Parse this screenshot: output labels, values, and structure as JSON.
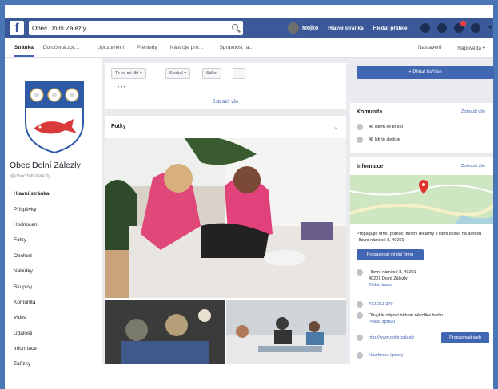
{
  "topbar": {
    "search_value": "Obec Dolní Zálezly",
    "user_name": "Mojko",
    "nav_home": "Hlavní stránka",
    "nav_find_friends": "Hledat přátele"
  },
  "tabs": {
    "items": [
      "Stránka",
      "Doručená zpr…",
      "Upozornění",
      "Přehledy",
      "Nástroje pro…",
      "Správnost ra…"
    ],
    "right": [
      "Nastavení",
      "Nápověda ▾"
    ]
  },
  "page": {
    "name": "Obec Dolní Zálezly",
    "handle": "@obecdolnizalezly"
  },
  "menu": {
    "items": [
      "Hlavní stránka",
      "Příspěvky",
      "Hodnocení",
      "Fotky",
      "Obchod",
      "Nabídky",
      "Skupiny",
      "Komunita",
      "Videa",
      "Události",
      "Informace",
      "Zařízky"
    ]
  },
  "actions": {
    "like": "To se mi líbí ▾",
    "follow": "Sledují ▾",
    "share": "Sdílet",
    "more": "···",
    "show_all": "Zobrazit vše"
  },
  "photos": {
    "title": "Fotky"
  },
  "right": {
    "add_button": "+ Přidat tlačítko",
    "community": {
      "title": "Komunita",
      "link": "Zobrazit vše",
      "likes": "48 lidem se to líbí",
      "follows": "48 lidí to sleduje"
    },
    "info": {
      "title": "Informace",
      "link": "Zobrazit vše",
      "promo_text": "Propagujte firmu pomocí místní reklamy s lidmi blízko na adresu Hlavní náměstí 8, 40201",
      "promo_button": "Propagovat místní firmu",
      "address_line1": "Hlavní náměstí 8, 40201",
      "address_line2": "40201 Dolní Zálezly",
      "directions": "Získat trasu",
      "phone": "472 213 370",
      "hours_line1": "Obvykle odpoví během několika hodin",
      "hours_line2": "Poslat zprávu",
      "website": "http://www.dolni-zalezly",
      "website_button": "Propagovat web",
      "suggest": "Navrhnout úpravy"
    }
  }
}
